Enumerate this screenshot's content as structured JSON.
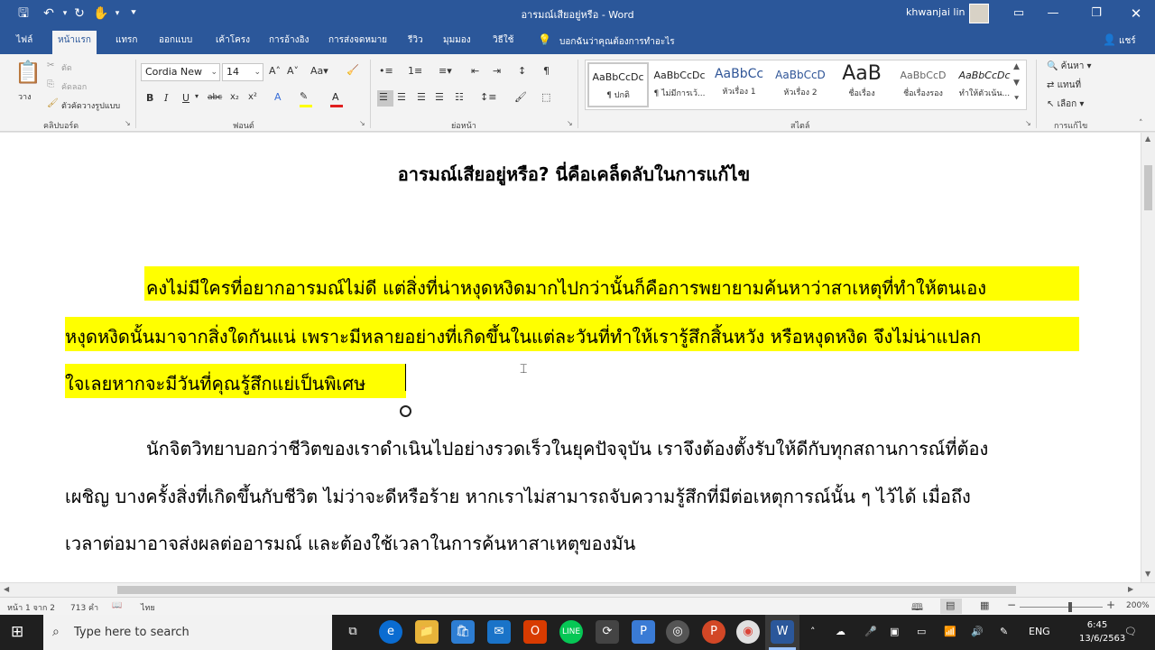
{
  "titlebar": {
    "doc_title": "อารมณ์เสียอยู่หรือ - Word",
    "user_name": "khwanjai lin"
  },
  "tabs": {
    "items": [
      "ไฟล์",
      "หน้าแรก",
      "แทรก",
      "ออกแบบ",
      "เค้าโครง",
      "การอ้างอิง",
      "การส่งจดหมาย",
      "รีวิว",
      "มุมมอง",
      "วิธีใช้"
    ],
    "tell_me": "บอกฉันว่าคุณต้องการทำอะไร",
    "share": "แชร์"
  },
  "ribbon": {
    "clipboard": {
      "paste": "วาง",
      "cut": "ตัด",
      "copy": "คัดลอก",
      "format_painter": "ตัวคัดวางรูปแบบ",
      "label": "คลิปบอร์ด"
    },
    "font": {
      "name": "Cordia New",
      "size": "14",
      "label": "ฟอนต์"
    },
    "paragraph": {
      "label": "ย่อหน้า"
    },
    "styles": {
      "label": "สไตล์",
      "items": [
        {
          "sample": "AaBbCcDc",
          "name": "¶ ปกติ"
        },
        {
          "sample": "AaBbCcDc",
          "name": "¶ ไม่มีการเว้..."
        },
        {
          "sample": "AaBbCc",
          "name": "หัวเรื่อง 1"
        },
        {
          "sample": "AaBbCcD",
          "name": "หัวเรื่อง 2"
        },
        {
          "sample": "AaB",
          "name": "ชื่อเรื่อง"
        },
        {
          "sample": "AaBbCcD",
          "name": "ชื่อเรื่องรอง"
        },
        {
          "sample": "AaBbCcDc",
          "name": "ทำให้ตัวเน้น..."
        }
      ]
    },
    "editing": {
      "find": "ค้นหา",
      "replace": "แทนที่",
      "select": "เลือก",
      "label": "การแก้ไข"
    }
  },
  "document": {
    "heading": "อารมณ์เสียอยู่หรือ? นี่คือเคล็ดลับในการแก้ไข",
    "para1": [
      "คงไม่มีใครที่อยากอารมณ์ไม่ดี แต่สิ่งที่น่าหงุดหงิดมากไปกว่านั้นก็คือการพยายามค้นหาว่าสาเหตุที่ทำให้ตนเอง",
      "หงุดหงิดนั้นมาจากสิ่งใดกันแน่ เพราะมีหลายอย่างที่เกิดขึ้นในแต่ละวันที่ทำให้เรารู้สึกสิ้นหวัง หรือหงุดหงิด จึงไม่น่าแปลก",
      "ใจเลยหากจะมีวันที่คุณรู้สึกแย่เป็นพิเศษ"
    ],
    "para2": [
      "นักจิตวิทยาบอกว่าชีวิตของเราดำเนินไปอย่างรวดเร็วในยุคปัจจุบัน เราจึงต้องตั้งรับให้ดีกับทุกสถานการณ์ที่ต้อง",
      "เผชิญ บางครั้งสิ่งที่เกิดขึ้นกับชีวิต ไม่ว่าจะดีหรือร้าย หากเราไม่สามารถจับความรู้สึกที่มีต่อเหตุการณ์นั้น ๆ ไว้ได้ เมื่อถึง",
      "เวลาต่อมาอาจส่งผลต่ออารมณ์ และต้องใช้เวลาในการค้นหาสาเหตุของมัน"
    ],
    "highlight_color": "#ffff00"
  },
  "statusbar": {
    "page": "หน้า 1 จาก 2",
    "words": "713 คำ",
    "language": "ไทย",
    "zoom": "200%"
  },
  "taskbar": {
    "search_placeholder": "Type here to search",
    "lang": "ENG",
    "time": "6:45",
    "date": "13/6/2563"
  },
  "colors": {
    "word_blue": "#2b579a",
    "highlight": "#ffff00"
  }
}
